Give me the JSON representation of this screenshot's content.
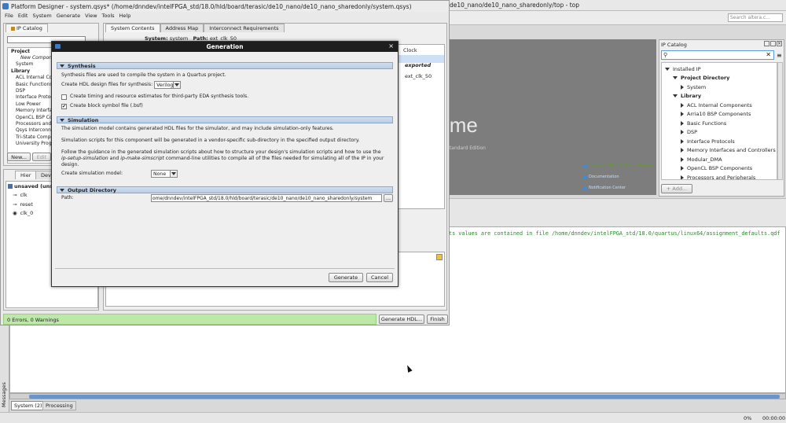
{
  "platform_window": {
    "title": "Platform Designer - system.qsys* (/home/dnndev/intelFPGA_std/18.0/hld/board/terasic/de10_nano/de10_nano_sharedonly/system.qsys)",
    "menu": [
      "File",
      "Edit",
      "System",
      "Generate",
      "View",
      "Tools",
      "Help"
    ],
    "ip_catalog_tab": "IP Catalog",
    "left_tree": [
      "Project",
      "New Component...",
      "System",
      "Library",
      "ACL Internal Compo...",
      "Basic Functions",
      "DSP",
      "Interface Protocols",
      "Low Power",
      "Memory Interfaces...",
      "OpenCL BSP Comp...",
      "Processors and Per...",
      "Qsys Interconnect",
      "Tri-State Compone...",
      "University Program"
    ],
    "new_button": "New...",
    "edit_button": "Edit",
    "hier_tabs": [
      "Hier",
      "Devi"
    ],
    "hier_root": "unsaved",
    "hier_root_suffix": "(unsaved...",
    "hier_items": [
      "clk",
      "reset",
      "clk_0"
    ],
    "main_tabs": [
      "System Contents",
      "Address Map",
      "Interconnect Requirements"
    ],
    "system_label": "System:",
    "system_name": "system",
    "path_label": "Path:",
    "path_value": "ext_clk_50",
    "col_clock": "Clock",
    "cell_exported": "exported",
    "cell_ext_clk": "ext_clk_50",
    "status_text": "0 Errors, 0 Warnings",
    "generate_hdl_button": "Generate HDL...",
    "finish_button": "Finish"
  },
  "quartus": {
    "title_fragment": "de10_nano/de10_nano_sharedonly/top - top",
    "search_placeholder": "Search altera.c...",
    "splash_word": "ime",
    "splash_edition": "Standard Edition",
    "splash_links": [
      "Download New Software Release",
      "Documentation",
      "Notification Center"
    ],
    "ip_catalog_title": "IP Catalog",
    "ip_tree": [
      {
        "label": "Installed IP",
        "level": 0,
        "exp": "open"
      },
      {
        "label": "Project Directory",
        "level": 1,
        "exp": "open",
        "bold": true
      },
      {
        "label": "System",
        "level": 2,
        "exp": "leaf"
      },
      {
        "label": "Library",
        "level": 1,
        "exp": "open",
        "bold": true
      },
      {
        "label": "ACL Internal Components",
        "level": 2,
        "exp": "closed"
      },
      {
        "label": "Arria10 BSP Components",
        "level": 2,
        "exp": "closed"
      },
      {
        "label": "Basic Functions",
        "level": 2,
        "exp": "closed"
      },
      {
        "label": "DSP",
        "level": 2,
        "exp": "closed"
      },
      {
        "label": "Interface Protocols",
        "level": 2,
        "exp": "closed"
      },
      {
        "label": "Memory Interfaces and Controllers",
        "level": 2,
        "exp": "closed"
      },
      {
        "label": "Modular_DMA",
        "level": 2,
        "exp": "closed"
      },
      {
        "label": "OpenCL BSP Components",
        "level": 2,
        "exp": "closed"
      },
      {
        "label": "Processors and Peripherals",
        "level": 2,
        "exp": "closed"
      }
    ],
    "add_button": "+ Add...",
    "message_line": "ts values are contained in file /home/dnndev/intelFPGA_std/18.0/quartus/linux64/assignment_defaults.qdf",
    "messages_label": "Messages",
    "bottom_tabs": [
      "System (2)",
      "Processing"
    ],
    "progress": "0%",
    "elapsed": "00:00:00"
  },
  "dialog": {
    "title": "Generation",
    "synthesis": {
      "header": "Synthesis",
      "desc": "Synthesis files are used to compile the system in a Quartus project.",
      "hdl_label": "Create HDL design files for synthesis:",
      "hdl_value": "Verilog",
      "timing_label": "Create timing and resource estimates for third-party EDA synthesis tools.",
      "bsf_label": "Create block symbol file (.bsf)"
    },
    "simulation": {
      "header": "Simulation",
      "desc1": "The simulation model contains generated HDL files for the simulator, and may include simulation-only features.",
      "desc2": "Simulation scripts for this component will be generated in a vendor-specific sub-directory in the specified output directory.",
      "desc3a": "Follow the guidance in the generated simulation scripts about how to structure your design's simulation scripts and how to use the",
      "desc3b_em1": "ip-setup-simulation",
      "desc3b_and": " and ",
      "desc3b_em2": "ip-make-simscript",
      "desc3b_rest": " command-line utilities to compile all of the files needed for simulating all of the IP in your",
      "desc3c": "design.",
      "model_label": "Create simulation model:",
      "model_value": "None"
    },
    "output": {
      "header": "Output Directory",
      "path_label": "Path:",
      "path_value": "ome/dnndev/intelFPGA_std/18.0/hld/board/terasic/de10_nano/de10_nano_sharedonly/system",
      "browse": "..."
    },
    "generate_button": "Generate",
    "cancel_button": "Cancel"
  }
}
